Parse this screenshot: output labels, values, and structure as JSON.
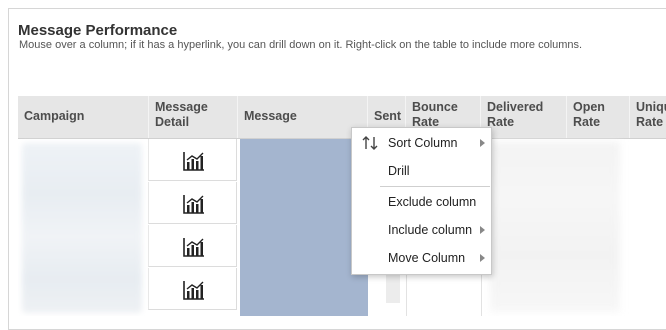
{
  "header": {
    "title": "Message Performance",
    "subtitle": "Mouse over a column; if it has a hyperlink, you can drill down on it. Right-click on the table to include more columns."
  },
  "table": {
    "columns": [
      {
        "label": "Campaign"
      },
      {
        "label": "Message\nDetail"
      },
      {
        "label": "Message"
      },
      {
        "label": "Sent"
      },
      {
        "label": "Bounce\nRate"
      },
      {
        "label": "Delivered\nRate"
      },
      {
        "label": "Open\nRate"
      },
      {
        "label": "Uniqu\nRate"
      }
    ],
    "row_icon": "bar-chart-trend-icon"
  },
  "context_menu": {
    "items": [
      {
        "label": "Sort Column",
        "icon": "sort-up-down-icon",
        "has_submenu": true
      },
      {
        "label": "Drill",
        "has_submenu": false
      },
      {
        "label": "Exclude column",
        "has_submenu": false
      },
      {
        "label": "Include column",
        "has_submenu": true
      },
      {
        "label": "Move Column",
        "has_submenu": true
      }
    ]
  }
}
